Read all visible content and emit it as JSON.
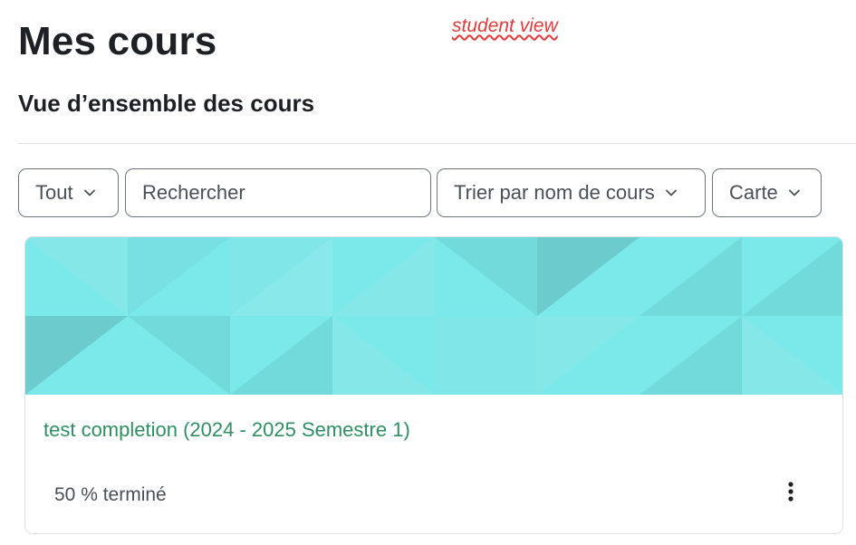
{
  "page": {
    "title": "Mes cours",
    "annotation": "student view",
    "section_title": "Vue d’ensemble des cours"
  },
  "filters": {
    "grouping": {
      "label": "Tout",
      "icon": "chevron-down-icon"
    },
    "search": {
      "placeholder": "Rechercher",
      "value": ""
    },
    "sort": {
      "label": "Trier par nom de cours",
      "icon": "chevron-down-icon"
    },
    "view": {
      "label": "Carte",
      "icon": "chevron-down-icon"
    }
  },
  "courses": [
    {
      "name": "test completion (2024 - 2025 Semestre 1)",
      "progress_text": "50 % terminé",
      "progress_fraction": 0.5,
      "menu_icon": "kebab-menu-icon",
      "image_colors": [
        "#7be9e9",
        "#72dada",
        "#86e7e9",
        "#6ccbcd"
      ]
    }
  ],
  "colors": {
    "title": "#1d2125",
    "annotation": "#e23b3b",
    "course_link": "#2f8f63",
    "control_border": "#6a737b",
    "muted_text": "#495057"
  }
}
